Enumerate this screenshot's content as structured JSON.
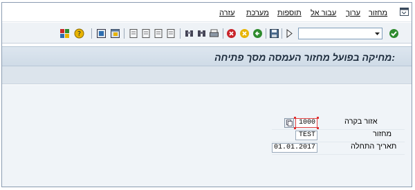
{
  "menu": {
    "items": [
      {
        "label": "מחזור",
        "key": "cycle"
      },
      {
        "label": "ערוך",
        "key": "edit"
      },
      {
        "label": "עבור אל",
        "key": "goto"
      },
      {
        "label": "תוספות",
        "key": "extras"
      },
      {
        "label": "מערכת",
        "key": "system"
      },
      {
        "label": "עזרה",
        "key": "help"
      }
    ]
  },
  "toolbar": {
    "command_field_value": "",
    "icons": [
      "checkmark-icon",
      "save-icon",
      "back-icon",
      "exit-icon",
      "cancel-icon",
      "print-icon",
      "find-icon",
      "find-next-icon",
      "first-page-icon",
      "previous-page-icon",
      "next-page-icon",
      "last-page-icon",
      "new-session-icon",
      "shortcut-icon",
      "help-icon",
      "customize-layout-icon"
    ]
  },
  "title": ":מחיקה בפועל מחזור העמסה מסך פתיחה",
  "form": {
    "fields": [
      {
        "label": "אזור בקרה",
        "value": "1000"
      },
      {
        "label": "מחזור",
        "value": "TEST"
      },
      {
        "label": "תאריך התחלה",
        "value": "01.01.2017"
      }
    ]
  },
  "colors": {
    "title_bg": "#d4dfe9",
    "content_bg": "#f0f4f8",
    "toolbar_bg": "#eef2f6",
    "focus_border": "#e04040"
  }
}
